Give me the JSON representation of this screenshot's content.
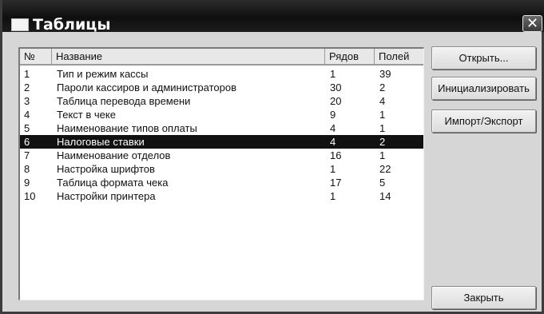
{
  "window": {
    "title": "Таблицы",
    "close_glyph": "✕"
  },
  "table": {
    "headers": {
      "num": "№",
      "name": "Название",
      "rows": "Рядов",
      "cols": "Полей"
    },
    "rows": [
      {
        "num": "1",
        "name": "Тип и режим кассы",
        "rows": "1",
        "cols": "39"
      },
      {
        "num": "2",
        "name": "Пароли кассиров и администраторов",
        "rows": "30",
        "cols": "2"
      },
      {
        "num": "3",
        "name": "Таблица перевода времени",
        "rows": "20",
        "cols": "4"
      },
      {
        "num": "4",
        "name": "Текст в чеке",
        "rows": "9",
        "cols": "1"
      },
      {
        "num": "5",
        "name": "Наименование типов оплаты",
        "rows": "4",
        "cols": "1"
      },
      {
        "num": "6",
        "name": "Налоговые ставки",
        "rows": "4",
        "cols": "2",
        "selected": true
      },
      {
        "num": "7",
        "name": "Наименование отделов",
        "rows": "16",
        "cols": "1"
      },
      {
        "num": "8",
        "name": "Настройка шрифтов",
        "rows": "1",
        "cols": "22"
      },
      {
        "num": "9",
        "name": "Таблица формата чека",
        "rows": "17",
        "cols": "5"
      },
      {
        "num": "10",
        "name": "Настройки принтера",
        "rows": "1",
        "cols": "14"
      }
    ]
  },
  "buttons": {
    "open": "Открыть...",
    "init": "Инициализировать",
    "import_export": "Импорт/Экспорт",
    "close": "Закрыть"
  }
}
